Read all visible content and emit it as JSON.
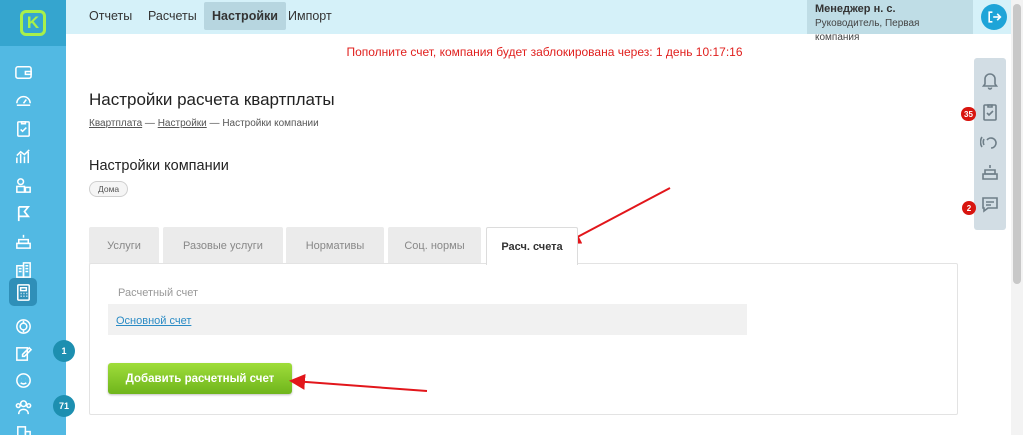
{
  "nav": {
    "tabs": [
      {
        "label": "Отчеты"
      },
      {
        "label": "Расчеты"
      },
      {
        "label": "Настройки"
      },
      {
        "label": "Импорт"
      }
    ],
    "active_tab": "Настройки"
  },
  "user": {
    "name": "Менеджер н. с.",
    "role": "Руководитель, Первая компания"
  },
  "alert": "Пополните счет, компания будет заблокирована через: 1 день 10:17:16",
  "page": {
    "title": "Настройки расчета квартплаты",
    "breadcrumb": [
      "Квартплата",
      "Настройки",
      "Настройки компании"
    ],
    "separator": "—",
    "section_title": "Настройки компании",
    "chip": "Дома"
  },
  "tabs": [
    {
      "label": "Услуги"
    },
    {
      "label": "Разовые услуги"
    },
    {
      "label": "Нормативы"
    },
    {
      "label": "Соц. нормы"
    },
    {
      "label": "Расч. счета"
    }
  ],
  "active_settings_tab": "Расч. счета",
  "accounts": {
    "label": "Расчетный счет",
    "items": [
      {
        "name": "Основной счет"
      }
    ],
    "add_button": "Добавить расчетный счет"
  },
  "sidebar": {
    "icons": [
      "wallet-icon",
      "gauge-icon",
      "checklist-icon",
      "chart-icon",
      "people-icon",
      "flag-icon",
      "cake-icon",
      "building-icon",
      "calculator-icon",
      "coins-icon",
      "edit-icon",
      "smile-icon",
      "group-icon",
      "office-icon"
    ],
    "active_icon": "calculator-icon",
    "badges": {
      "edit": "1",
      "group": "71"
    }
  },
  "rail": {
    "icons": [
      "bell-icon",
      "tasks-icon",
      "support-icon",
      "service-icon",
      "chat-icon"
    ],
    "badges": {
      "tasks": "35",
      "chat": "2"
    }
  },
  "colors": {
    "sidebar": "#52b9e3",
    "accent_green": "#8cd12c",
    "alert": "#e0201e",
    "topnav": "#d5f1f9"
  }
}
